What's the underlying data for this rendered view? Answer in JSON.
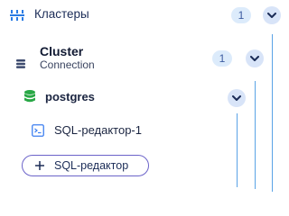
{
  "colors": {
    "accent": "#5aa3e6",
    "badge_bg": "#dcebfb",
    "chevron_bg": "#d8e4f8",
    "add_border": "#6b63c9",
    "db_green": "#28a745",
    "cluster_icon": "#3c4a6e",
    "heading_icon": "#2a7be4"
  },
  "header": {
    "icon": "clusters-icon",
    "title": "Кластеры",
    "count": "1",
    "toggle_icon": "chevron-down-icon"
  },
  "cluster": {
    "icon": "database-stack-icon",
    "name": "Cluster",
    "subtitle": "Connection",
    "count": "1",
    "toggle_icon": "chevron-down-icon"
  },
  "database": {
    "icon": "database-icon",
    "name": "postgres",
    "toggle_icon": "chevron-down-icon"
  },
  "editor": {
    "icon": "terminal-window-icon",
    "name": "SQL-редактор-1"
  },
  "add_editor": {
    "icon": "plus-icon",
    "label": "SQL-редактор"
  }
}
